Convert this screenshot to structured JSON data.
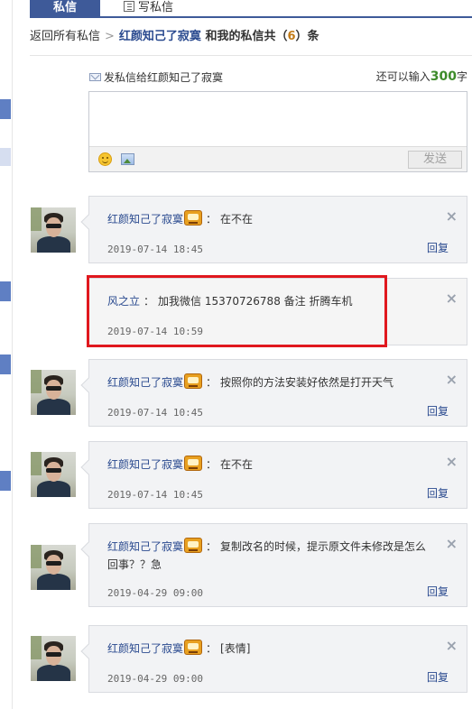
{
  "tabs": {
    "active": "私信",
    "write": "写私信"
  },
  "breadcrumb": {
    "back": "返回所有私信",
    "separator": ">",
    "title_user": "红颜知己了寂寞",
    "title_mid": " 和我的私信共（",
    "count": "6",
    "title_end": "）条"
  },
  "compose": {
    "label": "发私信给红颜知己了寂寞",
    "remain_prefix": "还可以输入",
    "remain_num": "300",
    "remain_suffix": "字",
    "send_label": "发送"
  },
  "messages": [
    {
      "sender": "红颜知己了寂寞",
      "text": "在不在",
      "time": "2019-07-14 18:45",
      "reply": "回复",
      "close": "×"
    },
    {
      "sender": "风之立",
      "text": "加我微信 15370726788 备注 折腾车机",
      "time": "2019-07-14 10:59",
      "reply": "",
      "close": "×"
    },
    {
      "sender": "红颜知己了寂寞",
      "text": "按照你的方法安装好依然是打开天气",
      "time": "2019-07-14 10:45",
      "reply": "回复",
      "close": "×"
    },
    {
      "sender": "红颜知己了寂寞",
      "text": "在不在",
      "time": "2019-07-14 10:45",
      "reply": "回复",
      "close": "×"
    },
    {
      "sender": "红颜知己了寂寞",
      "text": "复制改名的时候，提示原文件未修改是怎么回事？？急",
      "time": "2019-04-29 09:00",
      "reply": "回复",
      "close": "×"
    },
    {
      "sender": "红颜知己了寂寞",
      "text": "[表情]",
      "time": "2019-04-29 09:00",
      "reply": "回复",
      "close": "×"
    }
  ],
  "colors": {
    "accent": "#3e5a99",
    "link": "#2a4a8f",
    "highlight": "#e0181e",
    "count": "#c27b18",
    "remain": "#3d8b2a"
  }
}
